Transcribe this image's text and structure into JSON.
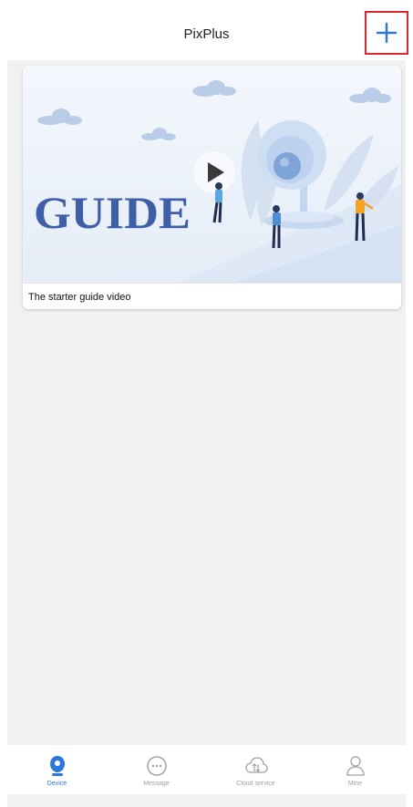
{
  "header": {
    "title": "PixPlus"
  },
  "guide": {
    "image_text": "GUIDE",
    "caption": "The starter guide video"
  },
  "tabs": [
    {
      "label": "Device",
      "icon": "device-icon",
      "active": true
    },
    {
      "label": "Message",
      "icon": "message-icon",
      "active": false
    },
    {
      "label": "Cloud service",
      "icon": "cloud-service-icon",
      "active": false
    },
    {
      "label": "Mine",
      "icon": "mine-icon",
      "active": false
    }
  ],
  "colors": {
    "accent": "#2a78d8",
    "highlight_border": "#d62828",
    "background": "#f1f1f1",
    "guide_text": "#3f5ea8",
    "inactive": "#a0a0a0"
  }
}
